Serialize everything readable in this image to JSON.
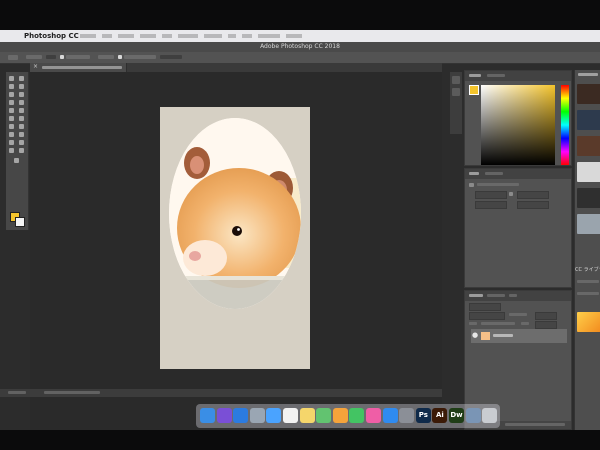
{
  "menubar": {
    "apple_glyph": "",
    "app_name": "Photoshop CC"
  },
  "window": {
    "title": "Adobe Photoshop CC 2018"
  },
  "document": {
    "tab_close_glyph": "×"
  },
  "tools": {
    "foreground_color": "#f4c42c",
    "background_color": "#f5f5f5"
  },
  "panels": {
    "color": {
      "selected_color": "#f4c42c"
    },
    "libraries": {
      "title": "CC ライブラリ"
    }
  },
  "dock": {
    "items": [
      {
        "name": "finder",
        "color": "#3a8ee6",
        "label": ""
      },
      {
        "name": "siri",
        "color": "#7a4fd6",
        "label": ""
      },
      {
        "name": "safari",
        "color": "#2b7be0",
        "label": ""
      },
      {
        "name": "launchpad",
        "color": "#9aa6b3",
        "label": ""
      },
      {
        "name": "mail",
        "color": "#4aa3ff",
        "label": ""
      },
      {
        "name": "calendar",
        "color": "#f2f2f2",
        "label": ""
      },
      {
        "name": "notes",
        "color": "#f5d66b",
        "label": ""
      },
      {
        "name": "maps",
        "color": "#62c370",
        "label": ""
      },
      {
        "name": "photos",
        "color": "#f5a33b",
        "label": ""
      },
      {
        "name": "messages",
        "color": "#43c463",
        "label": ""
      },
      {
        "name": "itunes",
        "color": "#ef5ea6",
        "label": ""
      },
      {
        "name": "app-store",
        "color": "#2f8bf0",
        "label": ""
      },
      {
        "name": "system-preferences",
        "color": "#8b8f97",
        "label": ""
      },
      {
        "name": "photoshop",
        "color": "#0f2a4a",
        "label": "Ps"
      },
      {
        "name": "illustrator",
        "color": "#3b1a07",
        "label": "Ai"
      },
      {
        "name": "dreamweaver",
        "color": "#1f3d17",
        "label": "Dw"
      },
      {
        "name": "preview",
        "color": "#7a95b5",
        "label": ""
      },
      {
        "name": "trash",
        "color": "#c9ccd1",
        "label": ""
      }
    ]
  }
}
